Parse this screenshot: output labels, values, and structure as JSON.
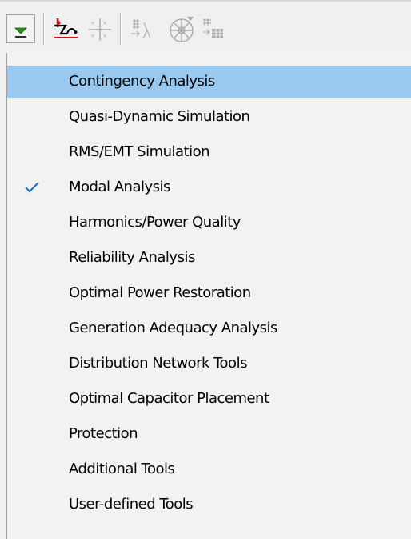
{
  "toolbar": {
    "buttons": [
      {
        "icon": "dropdown-arrow-icon"
      },
      {
        "icon": "short-circuit-icon"
      },
      {
        "icon": "load-flow-grid-icon"
      },
      {
        "icon": "eigenvalue-icon"
      },
      {
        "icon": "harmonics-wheel-icon"
      },
      {
        "icon": "table-output-icon"
      }
    ]
  },
  "menu": {
    "items": [
      {
        "label": "Contingency Analysis",
        "highlighted": true,
        "checked": false
      },
      {
        "label": "Quasi-Dynamic Simulation",
        "highlighted": false,
        "checked": false
      },
      {
        "label": "RMS/EMT Simulation",
        "highlighted": false,
        "checked": false
      },
      {
        "label": "Modal Analysis",
        "highlighted": false,
        "checked": true
      },
      {
        "label": "Harmonics/Power Quality",
        "highlighted": false,
        "checked": false
      },
      {
        "label": "Reliability Analysis",
        "highlighted": false,
        "checked": false
      },
      {
        "label": "Optimal Power Restoration",
        "highlighted": false,
        "checked": false
      },
      {
        "label": "Generation Adequacy Analysis",
        "highlighted": false,
        "checked": false
      },
      {
        "label": "Distribution Network Tools",
        "highlighted": false,
        "checked": false
      },
      {
        "label": "Optimal Capacitor Placement",
        "highlighted": false,
        "checked": false
      },
      {
        "label": "Protection",
        "highlighted": false,
        "checked": false
      },
      {
        "label": "Additional Tools",
        "highlighted": false,
        "checked": false
      },
      {
        "label": "User-defined Tools",
        "highlighted": false,
        "checked": false
      }
    ]
  },
  "colors": {
    "highlight": "#99c9ef",
    "check": "#1e73be",
    "dropdown_arrow": "#1f9a1f",
    "short_circuit_red": "#d01010"
  }
}
